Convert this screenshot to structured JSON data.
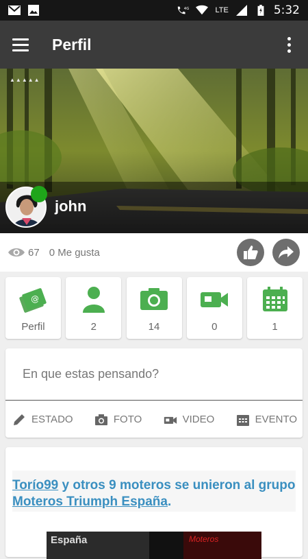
{
  "status_bar": {
    "time": "5:32",
    "network": "LTE",
    "signal_label": "4G",
    "icons": [
      "gmail-icon",
      "image-icon",
      "phone-4g-icon",
      "wifi-icon",
      "signal-icon",
      "battery-icon"
    ]
  },
  "app_bar": {
    "title": "Perfil",
    "menu_icon": "hamburger-icon",
    "more_icon": "overflow-menu-icon"
  },
  "profile": {
    "username": "john",
    "online_color": "#1fa51a",
    "views": "67",
    "likes": "0 Me gusta"
  },
  "tiles": [
    {
      "icon": "profile-card-icon",
      "label": "Perfil"
    },
    {
      "icon": "friends-icon",
      "label": "2"
    },
    {
      "icon": "camera-icon",
      "label": "14"
    },
    {
      "icon": "video-camera-icon",
      "label": "0"
    },
    {
      "icon": "calendar-icon",
      "label": "1"
    }
  ],
  "composer": {
    "placeholder": "En que estas pensando?",
    "actions": [
      {
        "icon": "pencil-icon",
        "label": "ESTADO"
      },
      {
        "icon": "camera-icon",
        "label": "FOTO"
      },
      {
        "icon": "video-icon",
        "label": "VIDEO"
      },
      {
        "icon": "calendar-icon",
        "label": "EVENTO"
      }
    ]
  },
  "feed": {
    "user_link": "Torío99",
    "middle_text": " y otros 9 moteros se unieron al grupo ",
    "group_link": "Moteros Triumph España",
    "end_text": ".",
    "image_caption_left": "España",
    "image_caption_right": "Moteros"
  },
  "colors": {
    "accent_green": "#4caf50",
    "app_bar": "#3b3b3b",
    "link_blue": "#3a8fc0"
  }
}
